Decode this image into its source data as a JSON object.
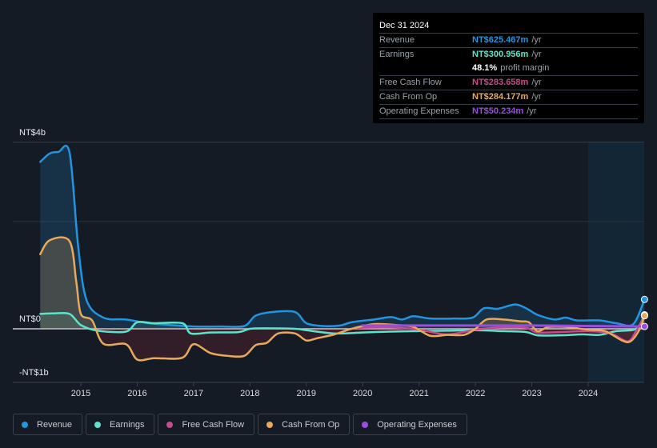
{
  "tooltip": {
    "date": "Dec 31 2024",
    "rows": [
      {
        "label": "Revenue",
        "value": "NT$625.467m",
        "unit": "/yr",
        "color": "#2394df"
      },
      {
        "label": "Earnings",
        "value": "NT$300.956m",
        "unit": "/yr",
        "color": "#5de3cc"
      },
      {
        "label": "",
        "value": "48.1%",
        "unit": "profit margin",
        "color": "#ffffff"
      },
      {
        "label": "Free Cash Flow",
        "value": "NT$283.658m",
        "unit": "/yr",
        "color": "#c94a8a"
      },
      {
        "label": "Cash From Op",
        "value": "NT$284.177m",
        "unit": "/yr",
        "color": "#e8a95a"
      },
      {
        "label": "Operating Expenses",
        "value": "NT$50.234m",
        "unit": "/yr",
        "color": "#9b4ce0"
      }
    ]
  },
  "legend": [
    {
      "label": "Revenue",
      "color": "#2394df"
    },
    {
      "label": "Earnings",
      "color": "#5de3cc"
    },
    {
      "label": "Free Cash Flow",
      "color": "#c94a8a"
    },
    {
      "label": "Cash From Op",
      "color": "#e8a95a"
    },
    {
      "label": "Operating Expenses",
      "color": "#9b4ce0"
    }
  ],
  "chart_data": {
    "type": "line",
    "title": "",
    "xlabel": "",
    "ylabel": "",
    "currency_unit": "NT$ billions",
    "ylim": [
      -1.15,
      4.0
    ],
    "xlim": [
      2014.0,
      2025.0
    ],
    "y_ticks": [
      {
        "value": 4,
        "label": "NT$4b"
      },
      {
        "value": 0,
        "label": "NT$0"
      },
      {
        "value": -1,
        "label": "-NT$1b"
      }
    ],
    "x_ticks": [
      "2015",
      "2016",
      "2017",
      "2018",
      "2019",
      "2020",
      "2021",
      "2022",
      "2023",
      "2024"
    ],
    "forecast_region_start": 2024.0,
    "grid": true,
    "legend_position": "bottom",
    "series": [
      {
        "name": "Revenue",
        "color": "#2394df",
        "filled": true,
        "points": [
          [
            2014.28,
            3.58
          ],
          [
            2014.45,
            3.76
          ],
          [
            2014.6,
            3.79
          ],
          [
            2014.8,
            3.78
          ],
          [
            2014.95,
            1.8
          ],
          [
            2015.1,
            0.62
          ],
          [
            2015.4,
            0.24
          ],
          [
            2015.8,
            0.2
          ],
          [
            2016.2,
            0.12
          ],
          [
            2016.6,
            0.08
          ],
          [
            2017.0,
            0.05
          ],
          [
            2017.5,
            0.05
          ],
          [
            2017.9,
            0.06
          ],
          [
            2018.1,
            0.28
          ],
          [
            2018.4,
            0.36
          ],
          [
            2018.8,
            0.36
          ],
          [
            2019.0,
            0.12
          ],
          [
            2019.3,
            0.06
          ],
          [
            2019.6,
            0.07
          ],
          [
            2019.8,
            0.14
          ],
          [
            2020.2,
            0.2
          ],
          [
            2020.5,
            0.25
          ],
          [
            2020.7,
            0.2
          ],
          [
            2020.9,
            0.27
          ],
          [
            2021.2,
            0.22
          ],
          [
            2021.6,
            0.22
          ],
          [
            2021.95,
            0.24
          ],
          [
            2022.15,
            0.44
          ],
          [
            2022.4,
            0.43
          ],
          [
            2022.7,
            0.52
          ],
          [
            2022.9,
            0.44
          ],
          [
            2023.1,
            0.3
          ],
          [
            2023.4,
            0.2
          ],
          [
            2023.6,
            0.24
          ],
          [
            2023.8,
            0.18
          ],
          [
            2024.2,
            0.18
          ],
          [
            2024.5,
            0.12
          ],
          [
            2024.8,
            0.1
          ],
          [
            2025.0,
            0.63
          ]
        ]
      },
      {
        "name": "Earnings",
        "color": "#5de3cc",
        "filled": true,
        "points": [
          [
            2014.28,
            0.32
          ],
          [
            2014.5,
            0.33
          ],
          [
            2014.8,
            0.32
          ],
          [
            2015.0,
            0.08
          ],
          [
            2015.3,
            -0.04
          ],
          [
            2015.8,
            -0.06
          ],
          [
            2016.0,
            0.14
          ],
          [
            2016.3,
            0.12
          ],
          [
            2016.8,
            0.12
          ],
          [
            2016.95,
            -0.1
          ],
          [
            2017.3,
            -0.08
          ],
          [
            2017.8,
            -0.07
          ],
          [
            2018.0,
            0.0
          ],
          [
            2018.3,
            0.01
          ],
          [
            2018.8,
            0.0
          ],
          [
            2019.0,
            -0.03
          ],
          [
            2019.5,
            -0.1
          ],
          [
            2020.0,
            -0.08
          ],
          [
            2020.5,
            -0.06
          ],
          [
            2021.0,
            -0.05
          ],
          [
            2021.5,
            -0.04
          ],
          [
            2022.0,
            -0.03
          ],
          [
            2022.5,
            -0.05
          ],
          [
            2022.9,
            -0.07
          ],
          [
            2023.1,
            -0.14
          ],
          [
            2023.5,
            -0.14
          ],
          [
            2023.9,
            -0.12
          ],
          [
            2024.2,
            -0.13
          ],
          [
            2024.5,
            -0.05
          ],
          [
            2024.85,
            0.0
          ],
          [
            2025.0,
            0.3
          ]
        ]
      },
      {
        "name": "Free Cash Flow",
        "color": "#c94a8a",
        "filled": true,
        "points": [
          [
            2019.9,
            0.02
          ],
          [
            2020.5,
            0.03
          ],
          [
            2021.0,
            -0.02
          ],
          [
            2021.5,
            -0.12
          ],
          [
            2022.0,
            -0.02
          ],
          [
            2022.5,
            0.03
          ],
          [
            2022.9,
            0.02
          ],
          [
            2023.1,
            -0.08
          ],
          [
            2023.5,
            -0.07
          ],
          [
            2024.0,
            -0.05
          ],
          [
            2024.4,
            -0.1
          ],
          [
            2024.7,
            -0.27
          ],
          [
            2024.85,
            -0.05
          ],
          [
            2025.0,
            0.28
          ]
        ]
      },
      {
        "name": "Cash From Op",
        "color": "#e8a95a",
        "filled": true,
        "points": [
          [
            2014.28,
            1.6
          ],
          [
            2014.45,
            1.9
          ],
          [
            2014.8,
            1.88
          ],
          [
            2014.92,
            1.0
          ],
          [
            2015.0,
            0.32
          ],
          [
            2015.2,
            0.18
          ],
          [
            2015.4,
            -0.32
          ],
          [
            2015.8,
            -0.33
          ],
          [
            2016.0,
            -0.66
          ],
          [
            2016.3,
            -0.63
          ],
          [
            2016.8,
            -0.62
          ],
          [
            2017.0,
            -0.33
          ],
          [
            2017.3,
            -0.52
          ],
          [
            2017.6,
            -0.58
          ],
          [
            2017.9,
            -0.58
          ],
          [
            2018.1,
            -0.35
          ],
          [
            2018.3,
            -0.3
          ],
          [
            2018.5,
            -0.1
          ],
          [
            2018.8,
            -0.1
          ],
          [
            2019.0,
            -0.25
          ],
          [
            2019.2,
            -0.2
          ],
          [
            2019.5,
            -0.12
          ],
          [
            2019.8,
            0.0
          ],
          [
            2020.2,
            0.1
          ],
          [
            2020.6,
            0.08
          ],
          [
            2020.9,
            0.04
          ],
          [
            2021.2,
            -0.15
          ],
          [
            2021.5,
            -0.13
          ],
          [
            2021.8,
            -0.13
          ],
          [
            2022.0,
            0.0
          ],
          [
            2022.2,
            0.2
          ],
          [
            2022.5,
            0.2
          ],
          [
            2022.8,
            0.16
          ],
          [
            2022.95,
            0.14
          ],
          [
            2023.1,
            -0.05
          ],
          [
            2023.3,
            0.04
          ],
          [
            2023.6,
            0.04
          ],
          [
            2024.0,
            -0.02
          ],
          [
            2024.3,
            -0.05
          ],
          [
            2024.6,
            -0.25
          ],
          [
            2024.75,
            -0.27
          ],
          [
            2024.9,
            -0.04
          ],
          [
            2025.0,
            0.28
          ]
        ]
      },
      {
        "name": "Operating Expenses",
        "color": "#9b4ce0",
        "filled": false,
        "points": [
          [
            2020.0,
            0.07
          ],
          [
            2021.0,
            0.07
          ],
          [
            2022.0,
            0.07
          ],
          [
            2023.0,
            0.07
          ],
          [
            2024.0,
            0.06
          ],
          [
            2025.0,
            0.05
          ]
        ]
      }
    ]
  }
}
